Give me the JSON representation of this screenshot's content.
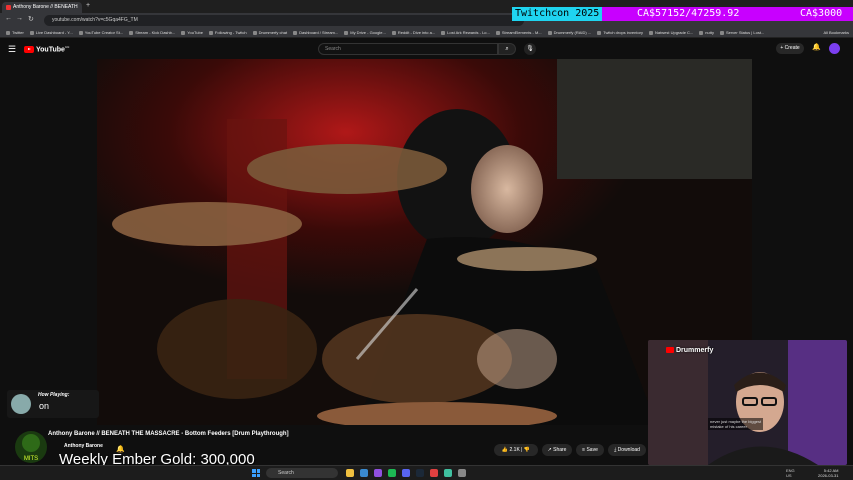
{
  "browser": {
    "tab_title": "Anthony Barone // BENEATH",
    "new_tab": "+",
    "url": "youtube.com/watch?v=c5Gqa4FG_TM",
    "bookmarks": [
      "Twitter",
      "Live Dashboard - Y...",
      "YouTube Creator St...",
      "Stream - Kick Dashb...",
      "YouTube",
      "Following - Twitch",
      "Drummerfy chat",
      "Dashboard / Stream...",
      "My Drive - Google...",
      "Reddit - Dive into a...",
      "Lost Ark Rewards - Lo...",
      "StreamElements - M...",
      "Drummerfy (RAID) ...",
      "Twitch drops inventory",
      "Natwest Upgrade C...",
      "nutty",
      "Server Status | Lost..."
    ],
    "all_bookmarks": "All Bookmarks"
  },
  "youtube": {
    "logo": "YouTube",
    "country": "GB",
    "search_placeholder": "Search",
    "create": "Create"
  },
  "overlay": {
    "twitch_tag": "Twitchcon 2025",
    "counter_left": "CA$57152/47259.92",
    "counter_right": "CA$3000"
  },
  "now_playing": {
    "label": "How Playing:",
    "track": "on"
  },
  "webcam": {
    "name": "Drummerfy",
    "chat_line1": "never just maybe the biggest",
    "chat_line2": "mistake of his career"
  },
  "video": {
    "title": "Anthony Barone // BENEATH THE MASSACRE - Bottom Feeders [Drum Playthrough]",
    "channel": "Anthony Barone",
    "likes": "2.1K",
    "share": "Share",
    "save": "Save",
    "download": "Download",
    "channel_logo_text": "MITS"
  },
  "goal": "Weekly Ember Gold: 300,000",
  "taskbar": {
    "search": "Search",
    "tray_lang": "ENG",
    "tray_region": "US",
    "time": "5:42 AM",
    "date": "2026-03-31"
  },
  "colors": {
    "youtube_red": "#ff0000",
    "twitch_purple": "#c800ff",
    "twitch_tag": "#1fd4f0"
  }
}
